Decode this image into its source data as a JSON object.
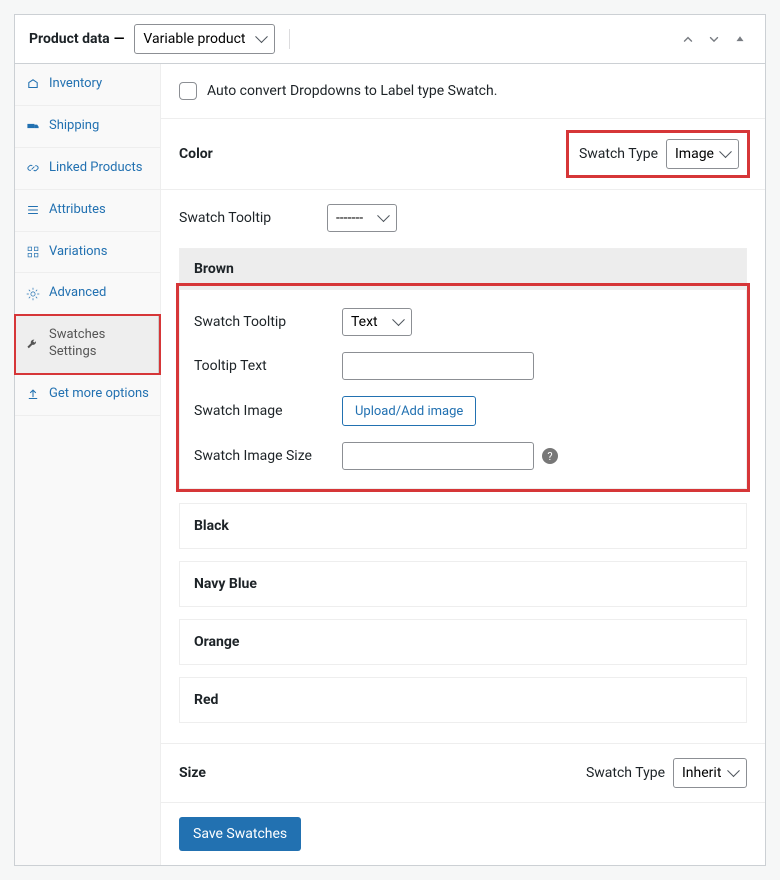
{
  "header": {
    "title": "Product data",
    "dash": "—",
    "product_type": "Variable product"
  },
  "sidebar": {
    "items": [
      {
        "label": "Inventory",
        "icon": "inventory-icon"
      },
      {
        "label": "Shipping",
        "icon": "shipping-icon"
      },
      {
        "label": "Linked Products",
        "icon": "link-icon"
      },
      {
        "label": "Attributes",
        "icon": "attributes-icon"
      },
      {
        "label": "Variations",
        "icon": "variations-icon"
      },
      {
        "label": "Advanced",
        "icon": "advanced-icon"
      },
      {
        "label": "Swatches Settings",
        "icon": "wrench-icon"
      },
      {
        "label": "Get more options",
        "icon": "share-icon"
      }
    ]
  },
  "auto_convert_label": "Auto convert Dropdowns to Label type Swatch.",
  "attributes": [
    {
      "name": "Color",
      "swatch_type_label": "Swatch Type",
      "swatch_type_value": "Image",
      "terms_tooltip_label": "Swatch Tooltip",
      "terms_tooltip_value": "-------",
      "open_term": {
        "name": "Brown",
        "fields": {
          "swatch_tooltip_label": "Swatch Tooltip",
          "swatch_tooltip_value": "Text",
          "tooltip_text_label": "Tooltip Text",
          "tooltip_text_value": "",
          "swatch_image_label": "Swatch Image",
          "upload_button": "Upload/Add image",
          "swatch_image_size_label": "Swatch Image Size",
          "swatch_image_size_value": ""
        }
      },
      "collapsed_terms": [
        "Black",
        "Navy Blue",
        "Orange",
        "Red"
      ]
    },
    {
      "name": "Size",
      "swatch_type_label": "Swatch Type",
      "swatch_type_value": "Inherit"
    }
  ],
  "save_button": "Save Swatches"
}
